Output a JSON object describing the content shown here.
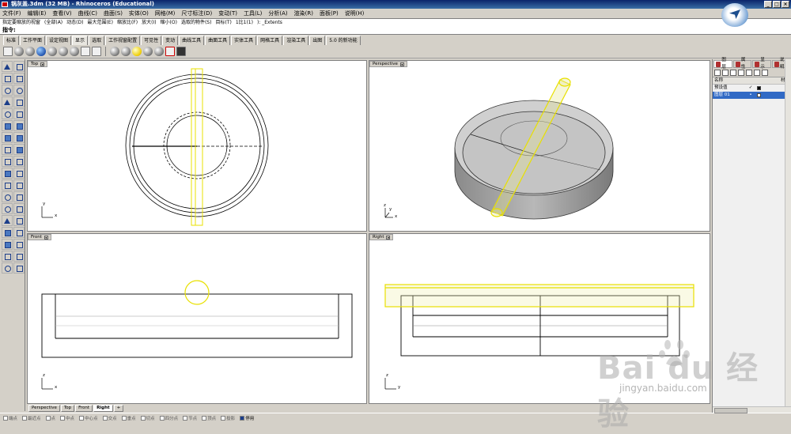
{
  "window": {
    "title": "锅灰盖.3dm (32 MB) - Rhinoceros (Educational)"
  },
  "menu": [
    "文件(F)",
    "编辑(E)",
    "查看(V)",
    "曲线(C)",
    "曲面(S)",
    "实体(O)",
    "网格(M)",
    "尺寸标注(D)",
    "变动(T)",
    "工具(L)",
    "分析(A)",
    "渲染(R)",
    "面板(P)",
    "说明(H)"
  ],
  "command_history": [
    "指定要缩放的视窗",
    "(全部(A)",
    "动态(D)",
    "最大范围(E)",
    "缩放比(F)",
    "放大(I)",
    "缩小(O)",
    "选取的物件(S)",
    "目标(T)",
    "1比1(1)",
    "): _Extents"
  ],
  "command_prompt": "指令:",
  "toolbar_tabs": [
    "标准",
    "工作平面",
    "设定视图",
    "显示",
    "选取",
    "工作视窗配置",
    "可见性",
    "变动",
    "曲线工具",
    "曲面工具",
    "实体工具",
    "网格工具",
    "渲染工具",
    "出图",
    "5.0 的新功能"
  ],
  "active_toolbar_tab": 3,
  "viewports": {
    "top": {
      "title": "Top",
      "axis_x": "x",
      "axis_y": "y"
    },
    "perspective": {
      "title": "Perspective",
      "axis_x": "x",
      "axis_y": "y",
      "axis_z": "z"
    },
    "front": {
      "title": "Front",
      "axis_x": "x",
      "axis_y": "z"
    },
    "right": {
      "title": "Right",
      "axis_x": "y",
      "axis_y": "z"
    }
  },
  "viewport_tabs": [
    "Perspective",
    "Top",
    "Front",
    "Right"
  ],
  "active_viewport_tab": 3,
  "osnaps": [
    {
      "label": "端点",
      "on": false
    },
    {
      "label": "最近点",
      "on": false
    },
    {
      "label": "点",
      "on": false
    },
    {
      "label": "中点",
      "on": false
    },
    {
      "label": "中心点",
      "on": false
    },
    {
      "label": "交点",
      "on": false
    },
    {
      "label": "垂点",
      "on": false
    },
    {
      "label": "切点",
      "on": false
    },
    {
      "label": "四分点",
      "on": false
    },
    {
      "label": "节点",
      "on": false
    },
    {
      "label": "顶点",
      "on": false
    },
    {
      "label": "投影",
      "on": false
    },
    {
      "label": "停用",
      "on": true
    }
  ],
  "layers_panel": {
    "tabs": [
      "图层",
      "属性",
      "显示",
      "说明"
    ],
    "column_name": "名称",
    "column_material": "材质",
    "rows": [
      {
        "name": "预设值",
        "current": true,
        "selected": false,
        "color": "#000000"
      },
      {
        "name": "图层 01",
        "current": false,
        "selected": true,
        "color": "#ffffff"
      }
    ]
  },
  "watermark": {
    "brand": "Bai du 经验",
    "url": "jingyan.baidu.com"
  },
  "colors": {
    "selection": "#e8e000",
    "title_bar": "#0a246a",
    "selected_layer": "#316ac5"
  }
}
